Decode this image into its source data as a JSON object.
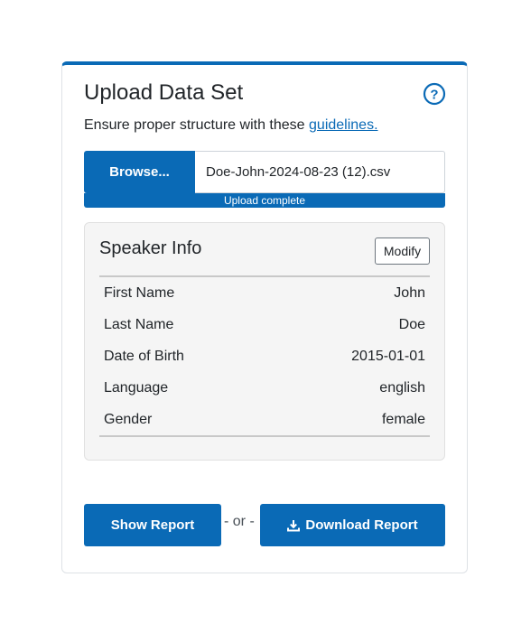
{
  "upload": {
    "title": "Upload Data Set",
    "subtitle_prefix": "Ensure proper structure with these ",
    "guidelines_link": "guidelines.",
    "browse_label": "Browse...",
    "file_name": "Doe-John-2024-08-23 (12).csv",
    "progress_label": "Upload complete",
    "progress_value": 1.0,
    "help_icon": "question-circle-icon"
  },
  "speaker_info": {
    "title": "Speaker Info",
    "modify_label": "Modify",
    "rows": [
      {
        "label": "First Name",
        "value": "John"
      },
      {
        "label": "Last Name",
        "value": "Doe"
      },
      {
        "label": "Date of Birth",
        "value": "2015-01-01"
      },
      {
        "label": "Language",
        "value": "english"
      },
      {
        "label": "Gender",
        "value": "female"
      }
    ]
  },
  "actions": {
    "show_report_label": "Show Report",
    "or_text": "- or -",
    "download_report_label": "Download Report",
    "download_icon": "download-icon"
  },
  "colors": {
    "primary": "#0a6ab6",
    "panel_bg": "#f5f5f5"
  }
}
